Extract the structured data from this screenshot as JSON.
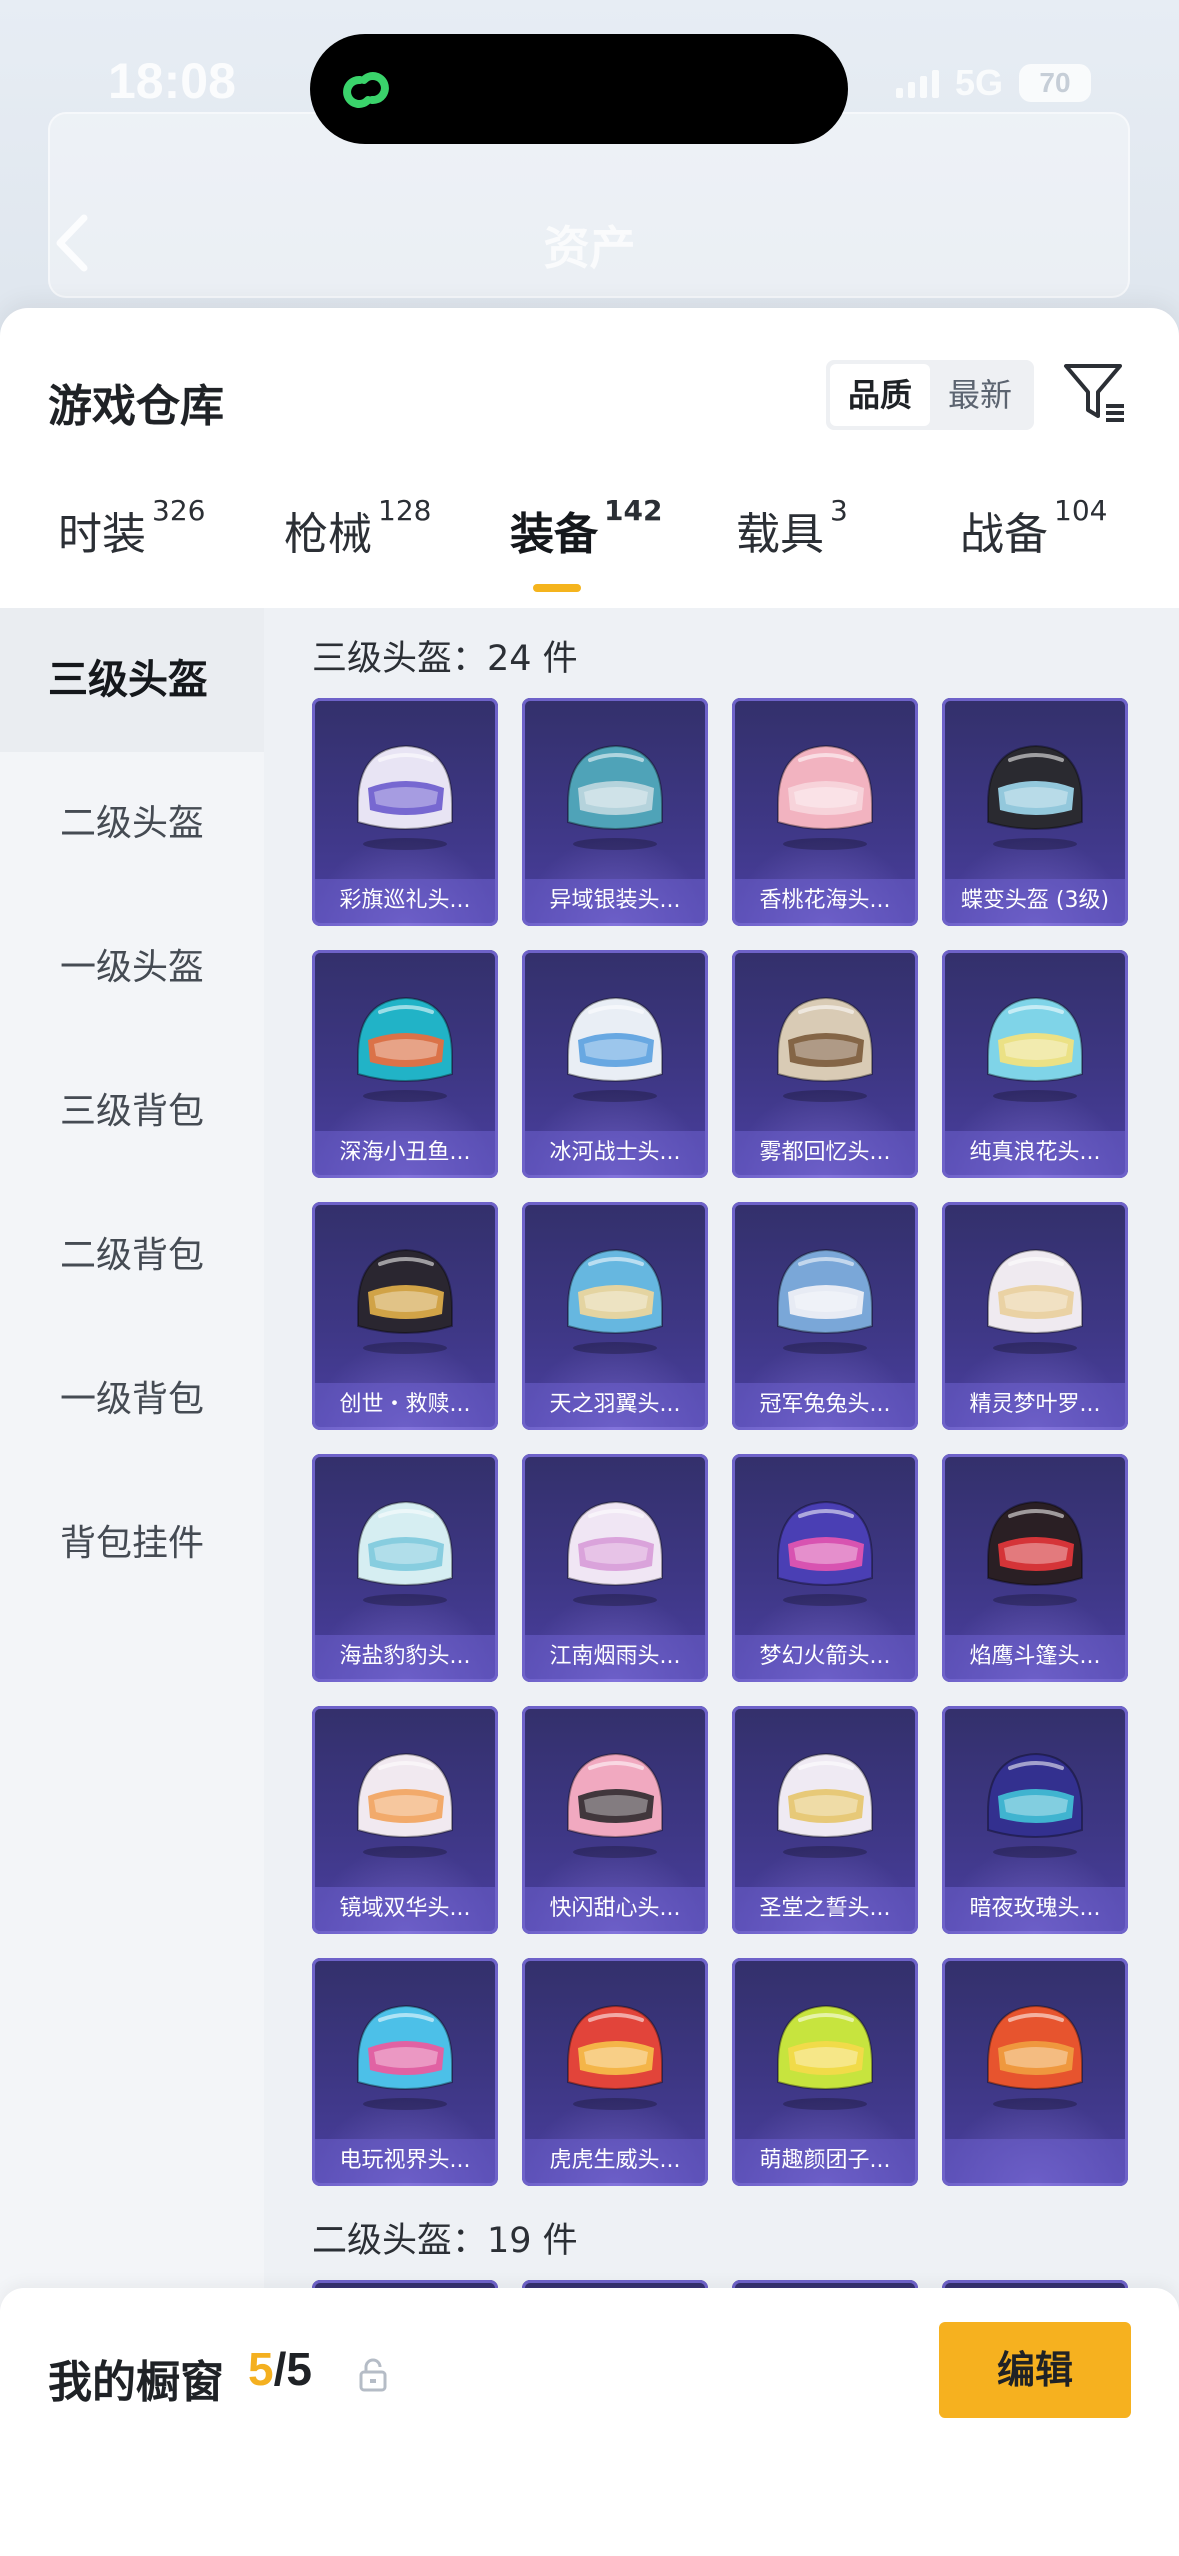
{
  "status_bar": {
    "time": "18:08",
    "network": "5G",
    "battery": "70"
  },
  "header": {
    "title": "资产"
  },
  "sheet": {
    "title": "游戏仓库",
    "sort_options": [
      "品质",
      "最新"
    ],
    "tabs": [
      {
        "label": "时装",
        "count": "326"
      },
      {
        "label": "枪械",
        "count": "128"
      },
      {
        "label": "装备",
        "count": "142"
      },
      {
        "label": "载具",
        "count": "3"
      },
      {
        "label": "战备",
        "count": "104"
      }
    ],
    "sidebar": [
      "三级头盔",
      "二级头盔",
      "一级头盔",
      "三级背包",
      "二级背包",
      "一级背包",
      "背包挂件"
    ],
    "groups": [
      {
        "title": "三级头盔：24 件"
      },
      {
        "title": "二级头盔：19 件"
      }
    ],
    "items": [
      {
        "name": "彩旗巡礼头...",
        "color": "#e8e4f4",
        "accent": "#6a5acd"
      },
      {
        "name": "异域银装头...",
        "color": "#4fa3b8",
        "accent": "#c0d8e0"
      },
      {
        "name": "香桃花海头...",
        "color": "#f2b3c0",
        "accent": "#f7d6dd"
      },
      {
        "name": "蝶变头盔 (3级)",
        "color": "#2a2a30",
        "accent": "#9fd9f0"
      },
      {
        "name": "深海小丑鱼...",
        "color": "#21b3c7",
        "accent": "#f06a3a"
      },
      {
        "name": "冰河战士头...",
        "color": "#e9eef5",
        "accent": "#5aa0e0"
      },
      {
        "name": "雾都回忆头...",
        "color": "#d9cbb5",
        "accent": "#7a5a3a"
      },
      {
        "name": "纯真浪花头...",
        "color": "#7fd4e8",
        "accent": "#f7e27a"
      },
      {
        "name": "创世・救赎...",
        "color": "#2a2630",
        "accent": "#e3b14a"
      },
      {
        "name": "天之羽翼头...",
        "color": "#66b7e0",
        "accent": "#f2d79a"
      },
      {
        "name": "冠军兔兔头...",
        "color": "#7aa7d8",
        "accent": "#f3f3f7"
      },
      {
        "name": "精灵梦叶罗...",
        "color": "#efeaf0",
        "accent": "#e9cf9b"
      },
      {
        "name": "海盐豹豹头...",
        "color": "#d6eef2",
        "accent": "#7ec9dd"
      },
      {
        "name": "江南烟雨头...",
        "color": "#f0e6f4",
        "accent": "#d79bd8"
      },
      {
        "name": "梦幻火箭头...",
        "color": "#4a3fb4",
        "accent": "#e855b0"
      },
      {
        "name": "焰鹰斗篷头...",
        "color": "#2a1f24",
        "accent": "#e8363b"
      },
      {
        "name": "镜域双华头...",
        "color": "#f1e9f0",
        "accent": "#f2a35c"
      },
      {
        "name": "快闪甜心头...",
        "color": "#f1a9c0",
        "accent": "#2e2a2e"
      },
      {
        "name": "圣堂之誓头...",
        "color": "#efeaf3",
        "accent": "#e6c56a"
      },
      {
        "name": "暗夜玫瑰头...",
        "color": "#33308f",
        "accent": "#41c3d7"
      },
      {
        "name": "电玩视界头...",
        "color": "#4cc0e8",
        "accent": "#f2589b"
      },
      {
        "name": "虎虎生威头...",
        "color": "#e2443a",
        "accent": "#f6c24a"
      },
      {
        "name": "萌趣颜团子...",
        "color": "#c7e43e",
        "accent": "#f5d94a"
      },
      {
        "name": "",
        "color": "#e7542e",
        "accent": "#f0a040"
      }
    ]
  },
  "bottom": {
    "label": "我的橱窗",
    "count_current": "5",
    "count_total": "/5",
    "edit_label": "编辑"
  },
  "colors": {
    "accent": "#f6b11f",
    "card_bg": "#3e3785",
    "card_border": "#6e62c9"
  }
}
